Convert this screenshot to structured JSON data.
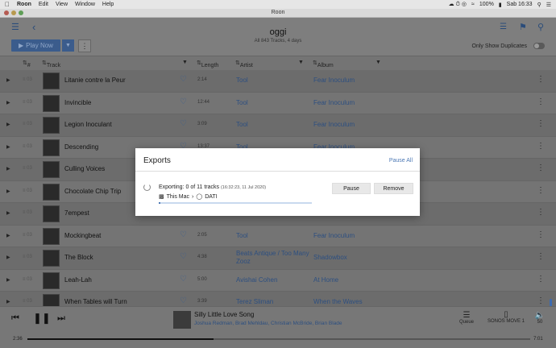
{
  "menubar": {
    "apple": "",
    "app": "Roon",
    "items": [
      "Edit",
      "View",
      "Window",
      "Help"
    ],
    "battery": "100%",
    "clock": "Sab 16:33"
  },
  "window": {
    "title": "Roon"
  },
  "header": {
    "playlist_title": "oggi",
    "playlist_subtitle": "All 843 Tracks, 4 days",
    "play_now_label": "Play Now",
    "only_duplicates_label": "Only Show Duplicates",
    "only_duplicates_on": false
  },
  "columns": {
    "num": "#",
    "track": "Track",
    "length": "Length",
    "artist": "Artist",
    "album": "Album"
  },
  "tracks": [
    {
      "name": "Litanie contre la Peur",
      "length": "2:14",
      "artist": "Tool",
      "album": "Fear Inoculum"
    },
    {
      "name": "Invincible",
      "length": "12:44",
      "artist": "Tool",
      "album": "Fear Inoculum"
    },
    {
      "name": "Legion Inoculant",
      "length": "3:09",
      "artist": "Tool",
      "album": "Fear Inoculum"
    },
    {
      "name": "Descending",
      "length": "13:37",
      "artist": "Tool",
      "album": "Fear Inoculum"
    },
    {
      "name": "Culling Voices",
      "length": "",
      "artist": "",
      "album": ""
    },
    {
      "name": "Chocolate Chip Trip",
      "length": "",
      "artist": "",
      "album": ""
    },
    {
      "name": "7empest",
      "length": "",
      "artist": "",
      "album": ""
    },
    {
      "name": "Mockingbeat",
      "length": "2:05",
      "artist": "Tool",
      "album": "Fear Inoculum"
    },
    {
      "name": "The Block",
      "length": "4:38",
      "artist": "Beats Antique / Too Many Zooz",
      "album": "Shadowbox"
    },
    {
      "name": "Leah-Lah",
      "length": "5:00",
      "artist": "Avishai Cohen",
      "album": "At Home"
    },
    {
      "name": "When Tables will Turn",
      "length": "3:39",
      "artist": "Terez Sliman",
      "album": "When the Waves"
    }
  ],
  "player": {
    "song": "Silly Little Love Song",
    "performers": "Joshua Redman, Brad Mehldau, Christian McBride, Brian Blade",
    "elapsed": "2:36",
    "duration": "7:01",
    "progress": 0.37,
    "queue_label": "Queue",
    "zone_label": "SONOS MOVE 1",
    "volume": "50"
  },
  "exports": {
    "title": "Exports",
    "pause_all": "Pause All",
    "exporting_label": "Exporting:",
    "exporting_status": "0 of 11 tracks",
    "exporting_time": "(16:32:23, 11 Jul 2020)",
    "source": "This Mac",
    "destination": "DATI",
    "pause_label": "Pause",
    "remove_label": "Remove",
    "progress": 0.01
  },
  "colors": {
    "accent": "#4d79b5",
    "link": "#2d4f80"
  }
}
